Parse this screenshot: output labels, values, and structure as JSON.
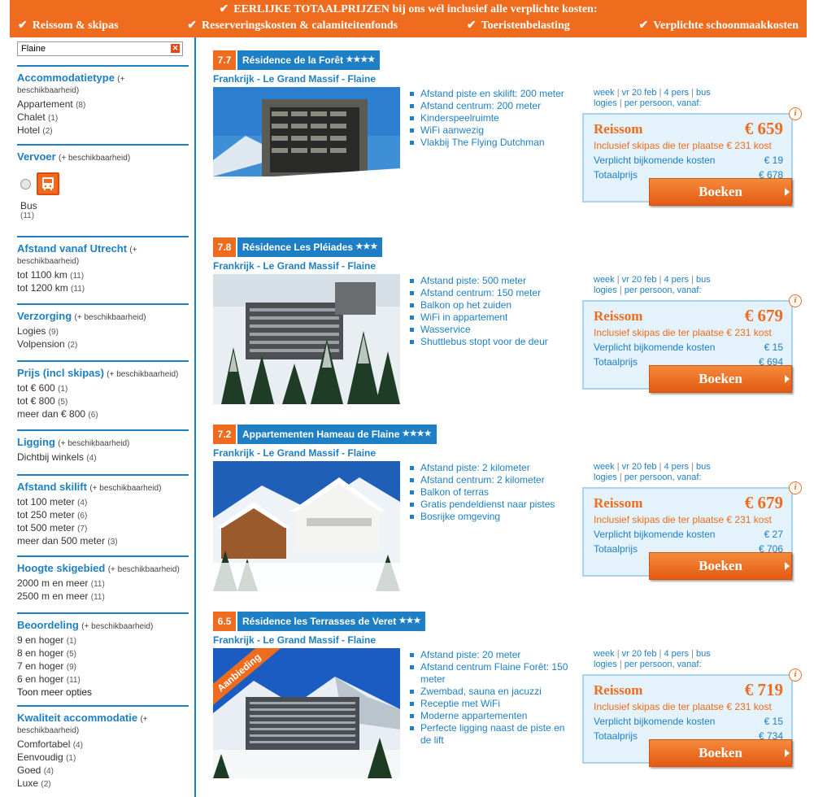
{
  "banner": {
    "headline": "EERLIJKE TOTAALPRIJZEN bij ons wél inclusief alle verplichte kosten:",
    "items": [
      "Reissom & skipas",
      "Reserveringskosten & calamiteitenfonds",
      "Toeristenbelasting",
      "Verplichte schoonmaakkosten"
    ],
    "check_icon": "checkmark-icon"
  },
  "search": {
    "value": "Flaine",
    "clear_icon": "close-icon"
  },
  "filters": [
    {
      "title": "Accommodatietype",
      "hint": "(+ beschikbaarheid)",
      "options": [
        {
          "label": "Appartement",
          "count": "(8)"
        },
        {
          "label": "Chalet",
          "count": "(1)"
        },
        {
          "label": "Hotel",
          "count": "(2)"
        }
      ]
    },
    {
      "title": "Vervoer",
      "hint": "(+ beschikbaarheid)",
      "bus_label": "Bus",
      "bus_count": "(11)",
      "bus_icon": "bus-icon"
    },
    {
      "title": "Afstand vanaf Utrecht",
      "hint": "(+ beschikbaarheid)",
      "options": [
        {
          "label": "tot 1100 km",
          "count": "(11)"
        },
        {
          "label": "tot 1200 km",
          "count": "(11)"
        }
      ]
    },
    {
      "title": "Verzorging",
      "hint": "(+ beschikbaarheid)",
      "options": [
        {
          "label": "Logies",
          "count": "(9)"
        },
        {
          "label": "Volpension",
          "count": "(2)"
        }
      ]
    },
    {
      "title": "Prijs (incl skipas)",
      "hint": "(+ beschikbaarheid)",
      "options": [
        {
          "label": "tot € 600",
          "count": "(1)"
        },
        {
          "label": "tot € 800",
          "count": "(5)"
        },
        {
          "label": "meer dan € 800",
          "count": "(6)"
        }
      ]
    },
    {
      "title": "Ligging",
      "hint": "(+ beschikbaarheid)",
      "options": [
        {
          "label": "Dichtbij winkels",
          "count": "(4)"
        }
      ]
    },
    {
      "title": "Afstand skilift",
      "hint": "(+ beschikbaarheid)",
      "options": [
        {
          "label": "tot 100 meter",
          "count": "(4)"
        },
        {
          "label": "tot 250 meter",
          "count": "(6)"
        },
        {
          "label": "tot 500 meter",
          "count": "(7)"
        },
        {
          "label": "meer dan 500 meter",
          "count": "(3)"
        }
      ]
    },
    {
      "title": "Hoogte skigebied",
      "hint": "(+ beschikbaarheid)",
      "options": [
        {
          "label": "2000 m en meer",
          "count": "(11)"
        },
        {
          "label": "2500 m en meer",
          "count": "(11)"
        }
      ]
    },
    {
      "title": "Beoordeling",
      "hint": "(+ beschikbaarheid)",
      "options": [
        {
          "label": "9 en hoger",
          "count": "(1)"
        },
        {
          "label": "8 en hoger",
          "count": "(5)"
        },
        {
          "label": "7 en hoger",
          "count": "(9)"
        },
        {
          "label": "6 en hoger",
          "count": "(11)"
        }
      ],
      "more": "Toon meer opties"
    },
    {
      "title": "Kwaliteit accommodatie",
      "hint": "(+ beschikbaarheid)",
      "options": [
        {
          "label": "Comfortabel",
          "count": "(4)"
        },
        {
          "label": "Eenvoudig",
          "count": "(1)"
        },
        {
          "label": "Goed",
          "count": "(4)"
        },
        {
          "label": "Luxe",
          "count": "(2)"
        }
      ]
    }
  ],
  "listings": [
    {
      "score": "7.7",
      "name": "Résidence de la Forêt",
      "stars": "★★★★",
      "location": "Frankrijk - Le Grand Massif - Flaine",
      "features": [
        "Afstand piste en skilift: 200 meter",
        "Afstand centrum: 200 meter",
        "Kinderspeelruimte",
        "WiFi aanwezig",
        "Vlakbij The Flying Dutchman"
      ],
      "meta_week": "week",
      "meta_date": "vr 20 feb",
      "meta_pers": "4 pers",
      "meta_bus": "bus",
      "meta_logies": "logies",
      "meta_per": "per persoon, vanaf:",
      "price_title": "Reissom",
      "price": "€ 659",
      "incl": "Inclusief skipas die ter plaatse € 231 kost",
      "extra_label": "Verplicht bijkomende kosten",
      "extra": "€ 19",
      "total_label": "Totaalprijs",
      "total": "€ 678",
      "book": "Boeken",
      "info_icon": "info-icon"
    },
    {
      "score": "7.8",
      "name": "Résidence Les Pléiades",
      "stars": "★★★",
      "location": "Frankrijk - Le Grand Massif - Flaine",
      "features": [
        "Afstand piste: 500 meter",
        "Afstand centrum: 150 meter",
        "Balkon op het zuiden",
        "WiFi in appartement",
        "Wasservice",
        "Shuttlebus stopt voor de deur"
      ],
      "meta_week": "week",
      "meta_date": "vr 20 feb",
      "meta_pers": "4 pers",
      "meta_bus": "bus",
      "meta_logies": "logies",
      "meta_per": "per persoon, vanaf:",
      "price_title": "Reissom",
      "price": "€ 679",
      "incl": "Inclusief skipas die ter plaatse € 231 kost",
      "extra_label": "Verplicht bijkomende kosten",
      "extra": "€ 15",
      "total_label": "Totaalprijs",
      "total": "€ 694",
      "book": "Boeken",
      "info_icon": "info-icon"
    },
    {
      "score": "7.2",
      "name": "Appartementen Hameau de Flaine",
      "stars": "★★★★",
      "location": "Frankrijk - Le Grand Massif - Flaine",
      "features": [
        "Afstand piste: 2 kilometer",
        "Afstand centrum: 2 kilometer",
        "Balkon of terras",
        "Gratis pendeldienst naar pistes",
        "Bosrijke omgeving"
      ],
      "meta_week": "week",
      "meta_date": "vr 20 feb",
      "meta_pers": "4 pers",
      "meta_bus": "bus",
      "meta_logies": "logies",
      "meta_per": "per persoon, vanaf:",
      "price_title": "Reissom",
      "price": "€ 679",
      "incl": "Inclusief skipas die ter plaatse € 231 kost",
      "extra_label": "Verplicht bijkomende kosten",
      "extra": "€ 27",
      "total_label": "Totaalprijs",
      "total": "€ 706",
      "book": "Boeken",
      "info_icon": "info-icon"
    },
    {
      "score": "6.5",
      "name": "Résidence les Terrasses de Veret",
      "stars": "★★★",
      "location": "Frankrijk - Le Grand Massif - Flaine",
      "ribbon": "Aanbieding",
      "features": [
        "Afstand piste: 20 meter",
        "Afstand centrum Flaine Forêt: 150 meter",
        "Zwembad, sauna en jacuzzi",
        "Receptie met WiFi",
        "Moderne appartementen",
        "Perfecte ligging naast de piste en de lift"
      ],
      "meta_week": "week",
      "meta_date": "vr 20 feb",
      "meta_pers": "4 pers",
      "meta_bus": "bus",
      "meta_logies": "logies",
      "meta_per": "per persoon, vanaf:",
      "price_title": "Reissom",
      "price": "€ 719",
      "incl": "Inclusief skipas die ter plaatse € 231 kost",
      "extra_label": "Verplicht bijkomende kosten",
      "extra": "€ 15",
      "total_label": "Totaalprijs",
      "total": "€ 734",
      "book": "Boeken",
      "info_icon": "info-icon"
    }
  ],
  "colors": {
    "accent": "#ef6b1e",
    "brand_blue": "#1e7fc4",
    "price_box_bg": "#e3f2fb"
  }
}
